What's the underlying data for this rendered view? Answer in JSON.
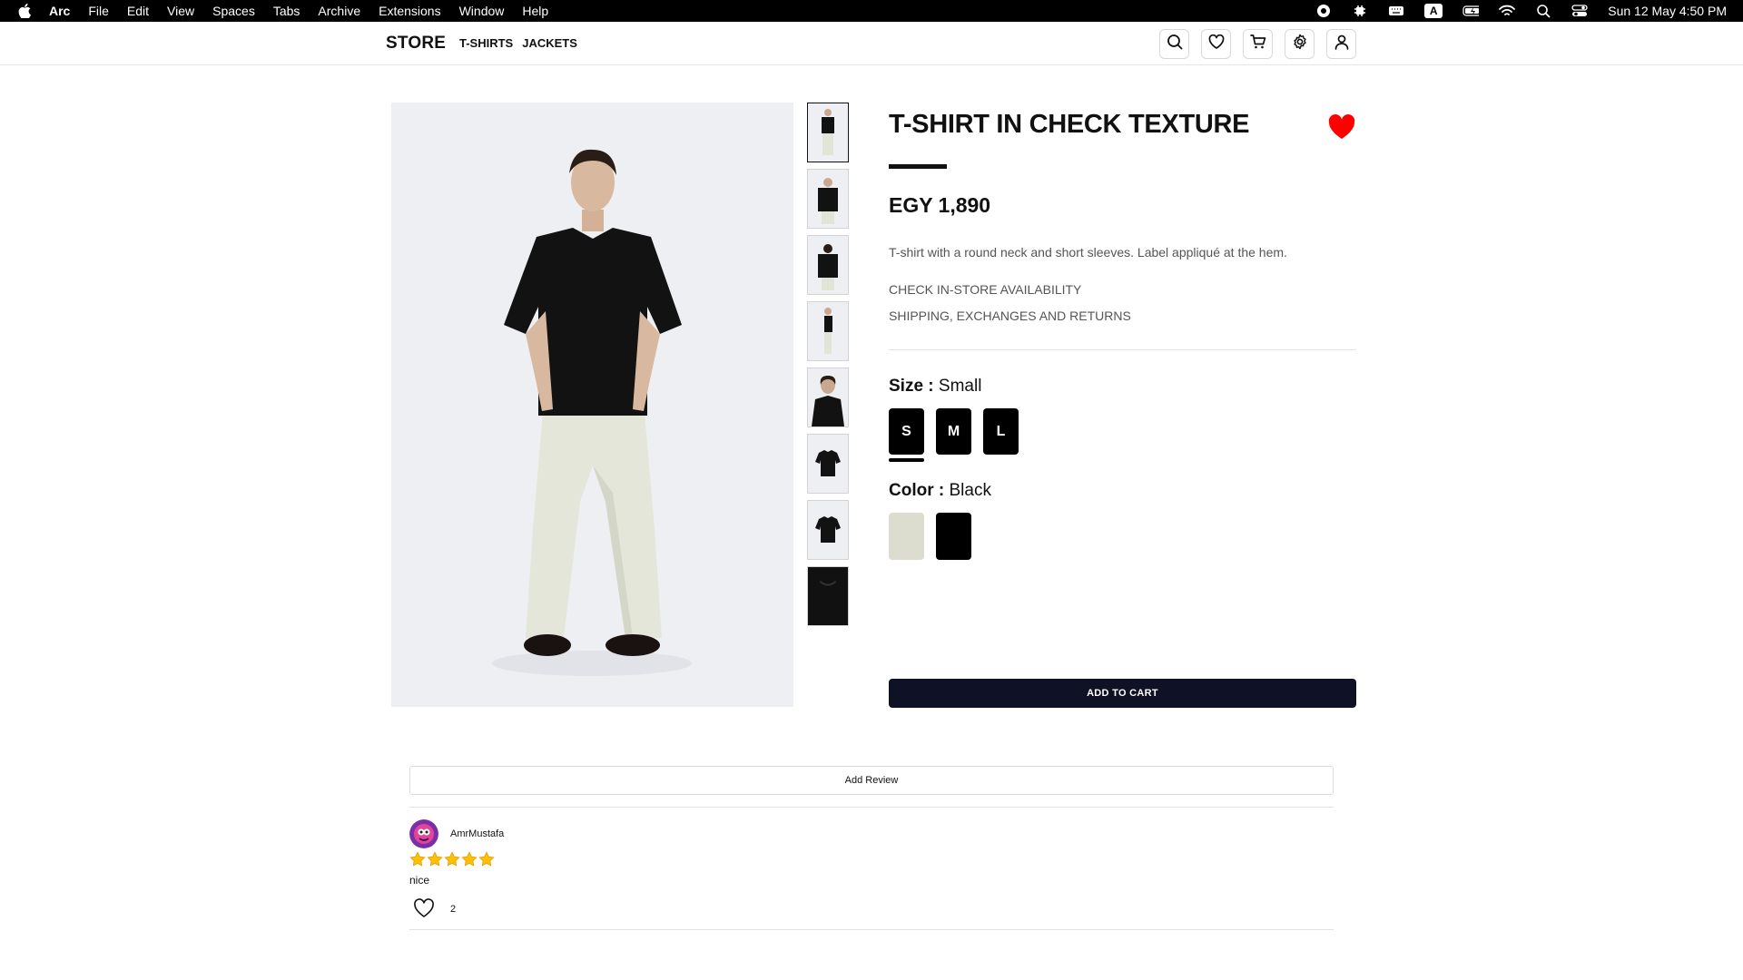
{
  "menubar": {
    "app_name": "Arc",
    "items": [
      "File",
      "Edit",
      "View",
      "Spaces",
      "Tabs",
      "Archive",
      "Extensions",
      "Window",
      "Help"
    ],
    "input_indicator": "A",
    "clock": "Sun 12 May  4:50 PM"
  },
  "store": {
    "brand": "STORE",
    "nav": [
      "T-SHIRTS",
      "JACKETS"
    ],
    "header_icons": [
      "search-icon",
      "heart-icon",
      "cart-icon",
      "gear-icon",
      "user-icon"
    ]
  },
  "product": {
    "title": "T-SHIRT IN CHECK TEXTURE",
    "price": "EGY 1,890",
    "description": "T-shirt with a round neck and short sleeves. Label appliqué at the hem.",
    "link_availability": "CHECK IN-STORE AVAILABILITY",
    "link_shipping": "SHIPPING, EXCHANGES AND RETURNS",
    "favorite_color": "#ff0000",
    "size": {
      "label": "Size :",
      "selected": "Small",
      "options": [
        "S",
        "M",
        "L"
      ]
    },
    "color": {
      "label": "Color :",
      "selected": "Black",
      "swatches": [
        "#dcdccf",
        "#000000"
      ]
    },
    "add_to_cart": "ADD TO CART",
    "thumbnail_count": 8
  },
  "reviews": {
    "add_review_label": "Add Review",
    "items": [
      {
        "user": "AmrMustafa",
        "rating": 5,
        "text": "nice",
        "likes": "2"
      }
    ]
  }
}
